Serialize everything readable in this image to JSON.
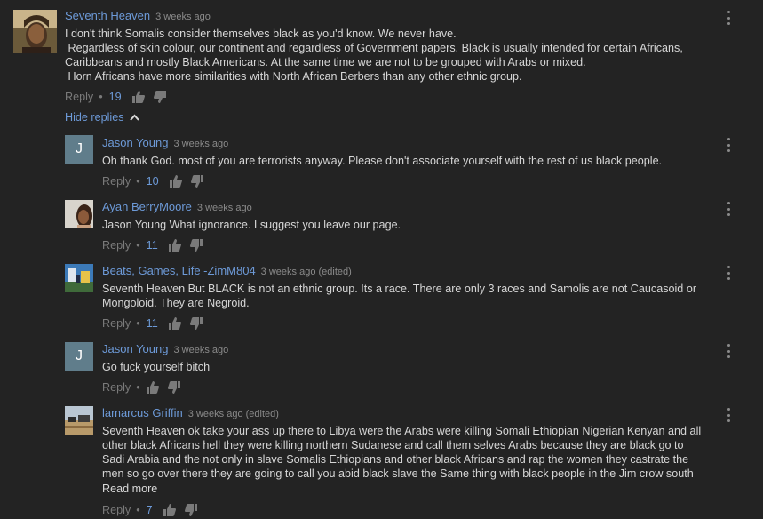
{
  "comments": [
    {
      "author": "Seventh Heaven",
      "time": "3 weeks ago",
      "lines": [
        "I don't think Somalis consider themselves black as you'd know. We never have.",
        " Regardless of skin colour, our continent and regardless of Government papers. Black is usually intended for certain Africans,",
        "Caribbeans and mostly Black Americans. At the same time we are not to be grouped with Arabs or mixed.",
        " Horn Africans have more similarities with North African Berbers than any other ethnic group."
      ],
      "reply_label": "Reply",
      "likes": "19"
    }
  ],
  "hide_replies_label": "Hide replies",
  "replies": [
    {
      "author": "Jason Young",
      "time": "3 weeks ago",
      "avatar_letter": "J",
      "lines": [
        "Oh thank God. most of you are terrorists anyway. Please don't associate yourself with the rest of us black people."
      ],
      "reply_label": "Reply",
      "likes": "10"
    },
    {
      "author": "Ayan BerryMoore",
      "time": "3 weeks ago",
      "lines": [
        "Jason Young What ignorance. I suggest you leave our page."
      ],
      "reply_label": "Reply",
      "likes": "11"
    },
    {
      "author": "Beats, Games, Life -ZimM804",
      "time": "3 weeks ago (edited)",
      "lines": [
        "Seventh Heaven But BLACK is not an ethnic group. Its a race. There are only 3 races and Samolis are not Caucasoid or",
        "Mongoloid. They are Negroid."
      ],
      "reply_label": "Reply",
      "likes": "11"
    },
    {
      "author": "Jason Young",
      "time": "3 weeks ago",
      "avatar_letter": "J",
      "lines": [
        "Go fuck yourself bitch"
      ],
      "reply_label": "Reply",
      "likes": ""
    },
    {
      "author": "lamarcus Griffin",
      "time": "3 weeks ago (edited)",
      "lines": [
        "Seventh Heaven ok take your ass up there to Libya were the Arabs were killing Somali Ethiopian Nigerian Kenyan and all",
        "other black Africans hell they were killing northern Sudanese and call them selves Arabs because they are black go to",
        "Sadi Arabia and the not only in slave Somalis Ethiopians and other black Africans and rap the women they castrate the",
        "men so go over there they are going to call you abid black slave the Same thing with black people in the Jim crow south"
      ],
      "read_more": "Read more",
      "reply_label": "Reply",
      "likes": "7"
    }
  ],
  "colors": {
    "background": "#232323",
    "author": "#6d9ad8",
    "avatar_letter_bg": "#607d8b"
  },
  "icons": [
    "thumbs-up-icon",
    "thumbs-down-icon",
    "more-vert-icon",
    "chevron-up-icon"
  ]
}
